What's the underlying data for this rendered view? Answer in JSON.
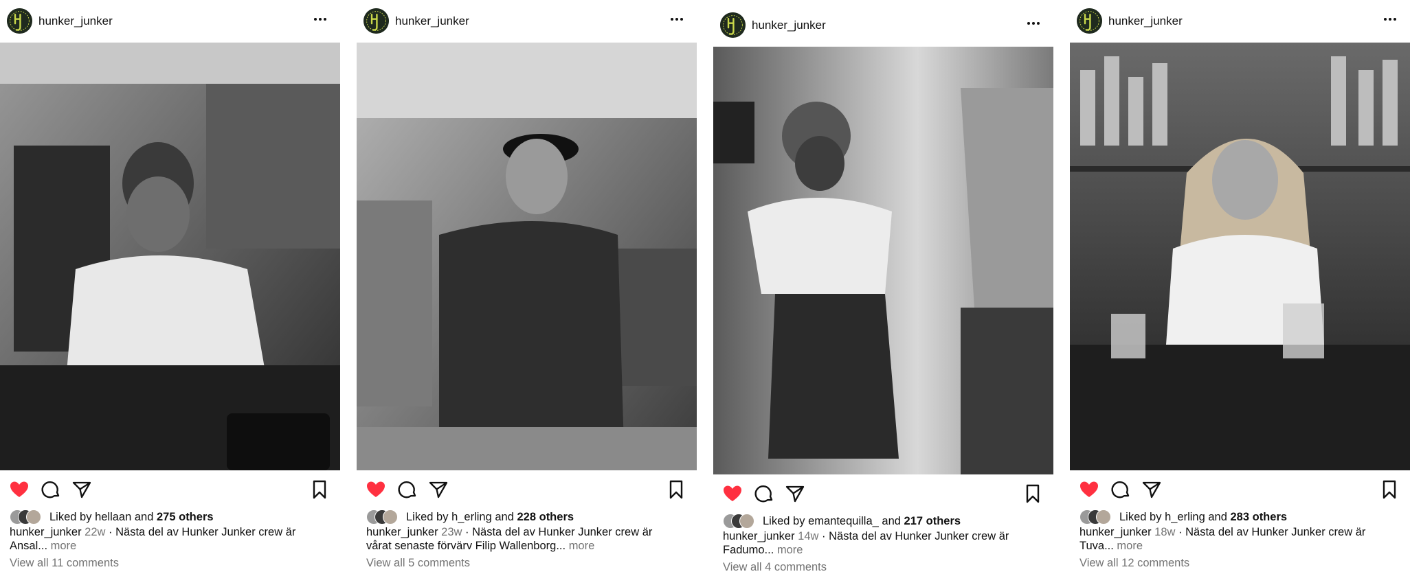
{
  "posts": [
    {
      "username": "hunker_junker",
      "liked_prefix": "Liked by",
      "liked_user": "hellaan",
      "liked_and": "and",
      "liked_others": "275 others",
      "caption_user": "hunker_junker",
      "time": "22w",
      "caption_line1": "· Nästa del av Hunker Junker crew är",
      "caption_line2": "Ansal...",
      "more": "more",
      "view_comments": "View all 11 comments",
      "liked": true
    },
    {
      "username": "hunker_junker",
      "liked_prefix": "Liked by",
      "liked_user": "h_erling",
      "liked_and": "and",
      "liked_others": "228 others",
      "caption_user": "hunker_junker",
      "time": "23w",
      "caption_line1": "· Nästa del av Hunker Junker crew är",
      "caption_line2": "vårat senaste förvärv Filip Wallenborg...",
      "more": "more",
      "view_comments": "View all 5 comments",
      "liked": true
    },
    {
      "username": "hunker_junker",
      "liked_prefix": "Liked by",
      "liked_user": "emantequilla_",
      "liked_and": "and",
      "liked_others": "217 others",
      "caption_user": "hunker_junker",
      "time": "14w",
      "caption_line1": "· Nästa del av Hunker Junker crew är",
      "caption_line2": "Fadumo...",
      "more": "more",
      "view_comments": "View all 4 comments",
      "liked": true
    },
    {
      "username": "hunker_junker",
      "liked_prefix": "Liked by",
      "liked_user": "h_erling",
      "liked_and": "and",
      "liked_others": "283 others",
      "caption_user": "hunker_junker",
      "time": "18w",
      "caption_line1": "· Nästa del av Hunker Junker crew är",
      "caption_line2": "Tuva...",
      "more": "more",
      "view_comments": "View all 12 comments",
      "liked": true
    }
  ],
  "colors": {
    "like": "#ff3040",
    "muted": "#737373",
    "brand_logo": "#c9d84a"
  },
  "icons": [
    "brand-avatar-icon",
    "more-options-icon",
    "heart-icon",
    "comment-icon",
    "share-icon",
    "bookmark-icon"
  ]
}
